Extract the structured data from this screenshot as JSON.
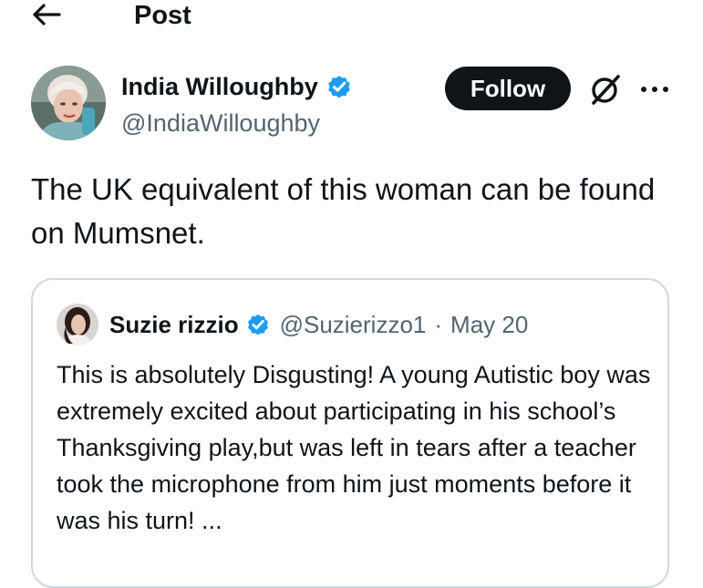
{
  "header": {
    "title": "Post",
    "back_icon": "arrow-left-icon"
  },
  "author": {
    "name": "India Willoughby",
    "handle": "@IndiaWilloughby",
    "verified": true,
    "verified_color": "#1d9bf0"
  },
  "actions": {
    "follow_label": "Follow",
    "grok_icon": "grok-icon",
    "more_icon": "more-dots-icon"
  },
  "post": {
    "text": "The UK equivalent of this woman can be found on Mumsnet."
  },
  "quote": {
    "name": "Suzie rizzio",
    "verified": true,
    "handle": "@Suzierizzo1",
    "separator": "·",
    "date": "May 20",
    "text": "This is absolutely Disgusting! A young Autistic boy was extremely excited about participating in his school’s  Thanksgiving play,but was left in tears after a teacher took the microphone from him just moments before it was  his turn! ..."
  },
  "colors": {
    "text": "#0f1419",
    "secondary_text": "#536471",
    "border": "#cfd9de",
    "follow_bg": "#0f1419",
    "follow_text": "#ffffff",
    "verified": "#1d9bf0"
  }
}
